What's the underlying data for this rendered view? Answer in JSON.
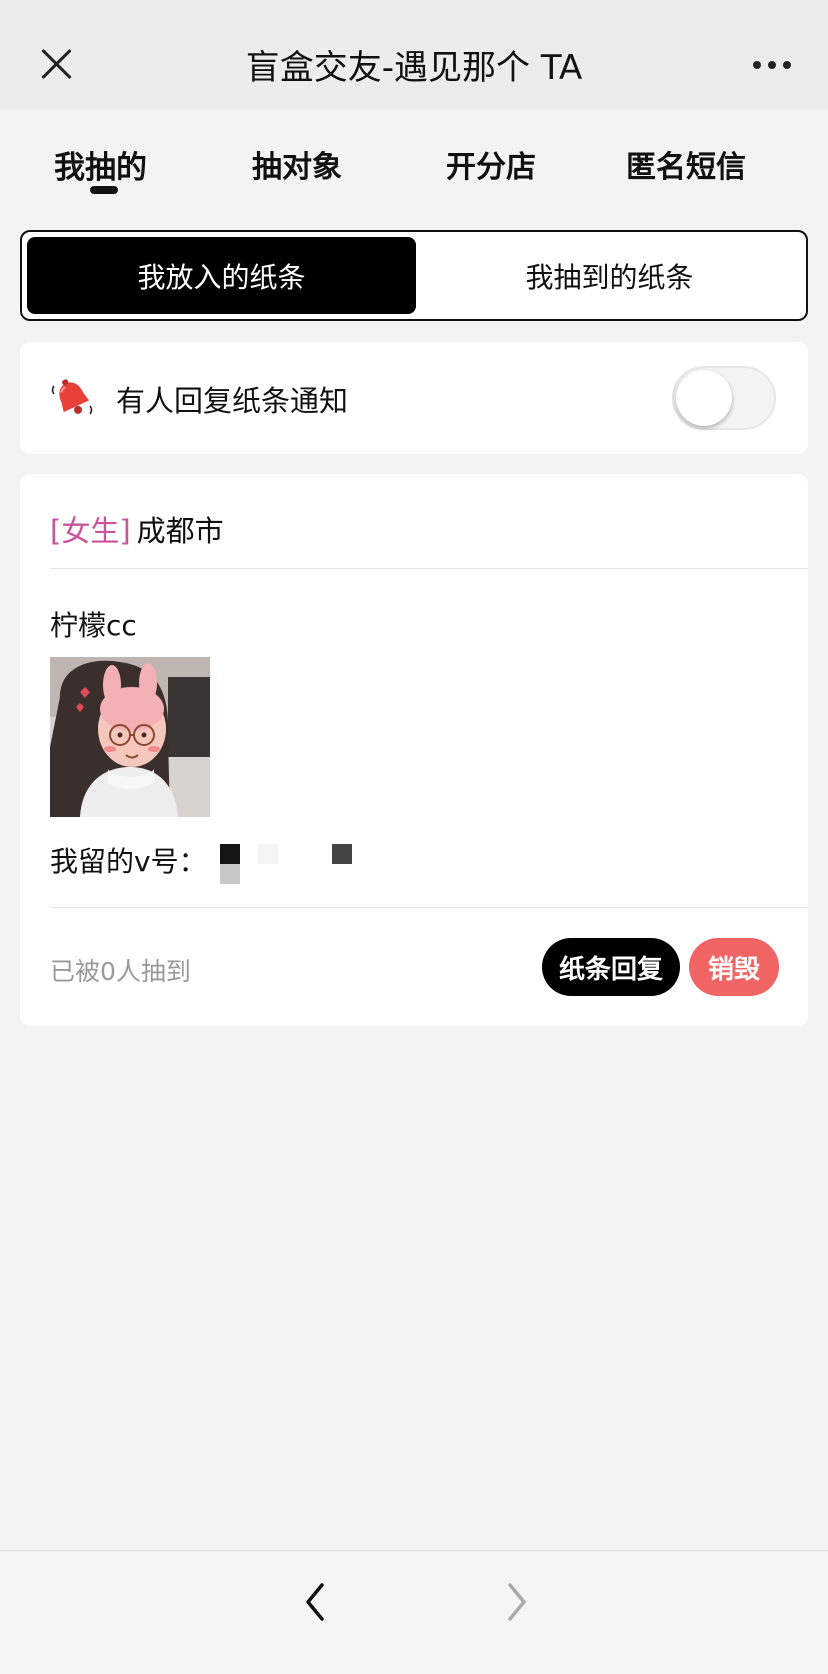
{
  "header": {
    "title": "盲盒交友-遇见那个 TA",
    "close_icon": "close-icon",
    "more_icon": "more-icon"
  },
  "tabs": [
    {
      "label": "我抽的",
      "active": true
    },
    {
      "label": "抽对象",
      "active": false
    },
    {
      "label": "开分店",
      "active": false
    },
    {
      "label": "匿名短信",
      "active": false
    }
  ],
  "segment": {
    "left_label": "我放入的纸条",
    "right_label": "我抽到的纸条",
    "selected": "我放入的纸条"
  },
  "notification": {
    "label": "有人回复纸条通知",
    "icon": "bell-icon",
    "enabled": false
  },
  "note": {
    "gender": "[女生]",
    "city": "成都市",
    "nickname": "柠檬cc",
    "wechat_label": "我留的v号：",
    "drawn_count_text": "已被0人抽到",
    "reply_button": "纸条回复",
    "destroy_button": "销毁"
  },
  "bottom_nav": {
    "back_icon": "chevron-left-icon",
    "forward_icon": "chevron-right-icon"
  },
  "colors": {
    "accent_black": "#000000",
    "gender_pink": "#c8559c",
    "destroy_red": "#f06464",
    "background": "#f3f3f3"
  }
}
